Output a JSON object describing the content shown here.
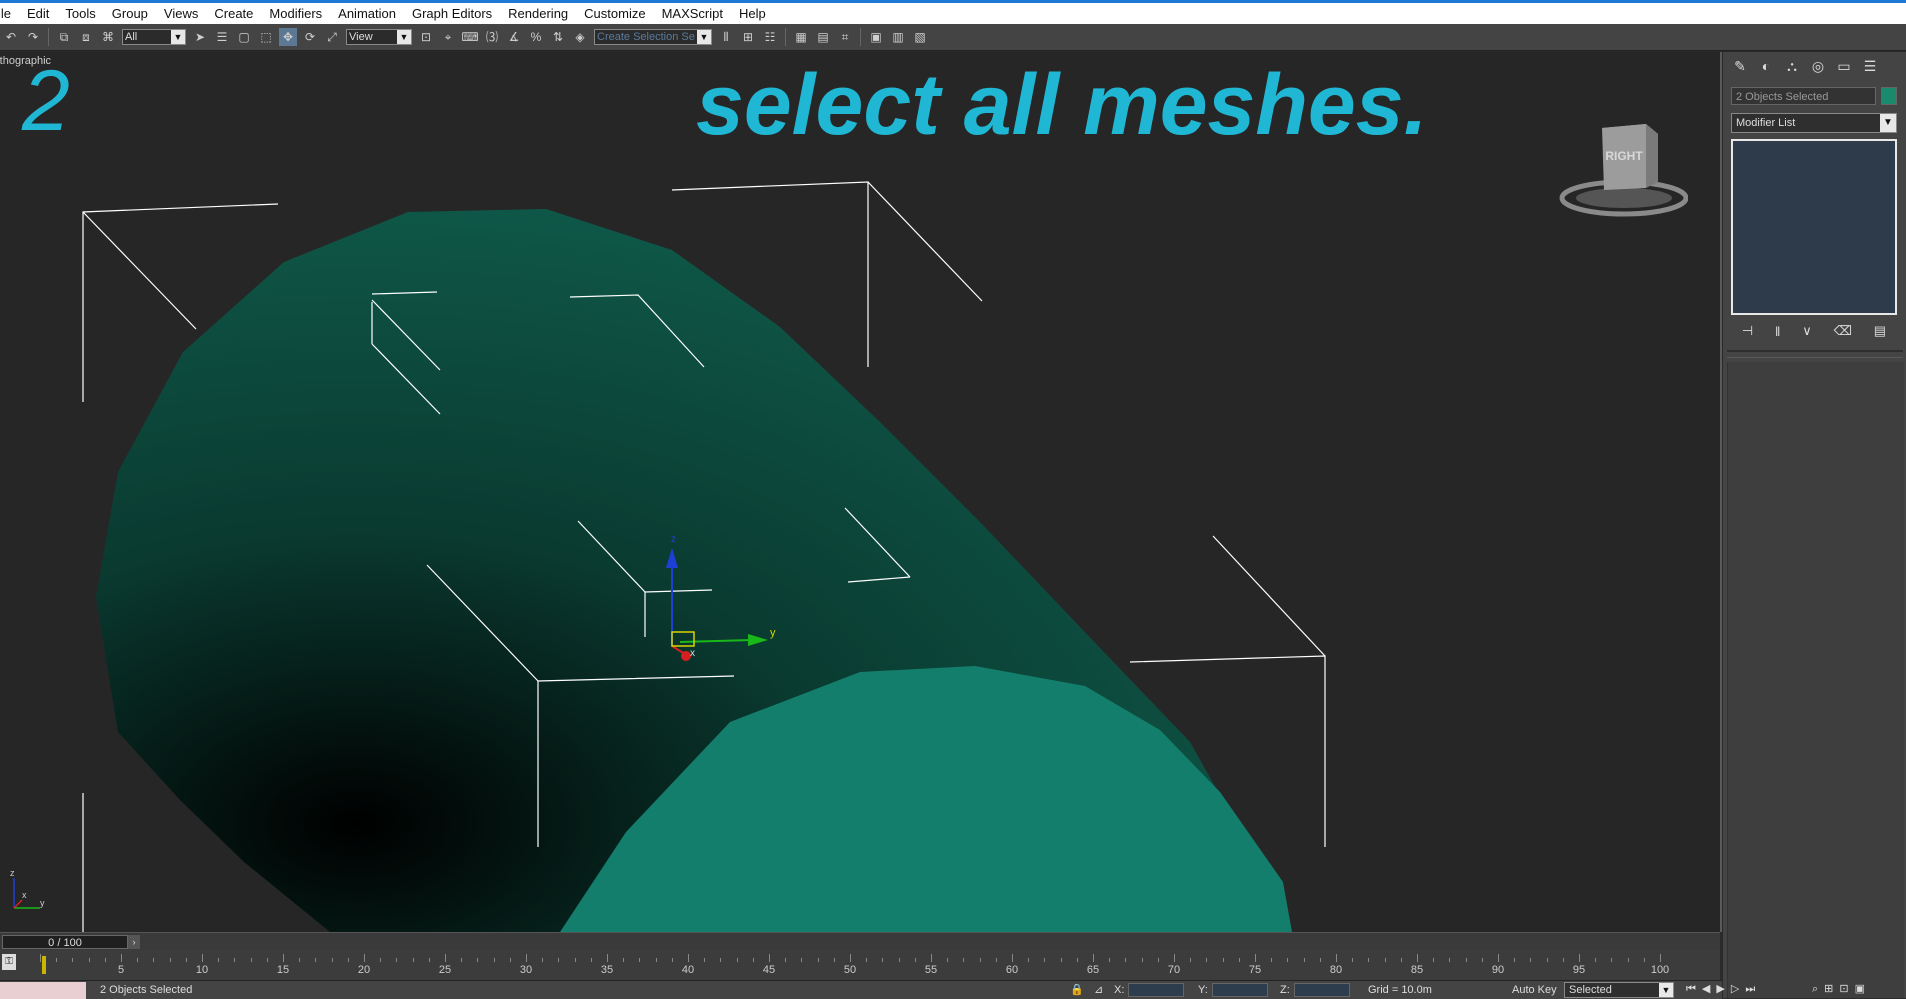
{
  "menu": {
    "items": [
      "ile",
      "Edit",
      "Tools",
      "Group",
      "Views",
      "Create",
      "Modifiers",
      "Animation",
      "Graph Editors",
      "Rendering",
      "Customize",
      "MAXScript",
      "Help"
    ]
  },
  "toolbar": {
    "selection_filter": "All",
    "ref_coord": "View",
    "named_selection_placeholder": "Create Selection Se"
  },
  "viewport": {
    "label": "rthographic",
    "step_number": "2",
    "instruction": "select all meshes.",
    "viewcube_label": "RIGHT",
    "gizmo_axis_x": "x",
    "gizmo_axis_y": "y",
    "gizmo_axis_z": "z",
    "corner_axis_x": "x",
    "corner_axis_y": "y",
    "corner_axis_z": "z",
    "mesh_colors": {
      "dark": "#0f5a4a",
      "light": "#147e6c"
    }
  },
  "command_panel": {
    "name_field": "2 Objects Selected",
    "object_color": "#1a8a6d",
    "modifier_list": "Modifier List"
  },
  "timeline": {
    "slider_text": "0 / 100",
    "ticks": [
      "5",
      "10",
      "15",
      "20",
      "25",
      "30",
      "35",
      "40",
      "45",
      "50",
      "55",
      "60",
      "65",
      "70",
      "75",
      "80",
      "85",
      "90",
      "95",
      "100"
    ]
  },
  "status": {
    "selection_text": "2 Objects Selected",
    "x_label": "X:",
    "y_label": "Y:",
    "z_label": "Z:",
    "grid_text": "Grid = 10.0m",
    "auto_key": "Auto Key",
    "key_mode": "Selected"
  }
}
